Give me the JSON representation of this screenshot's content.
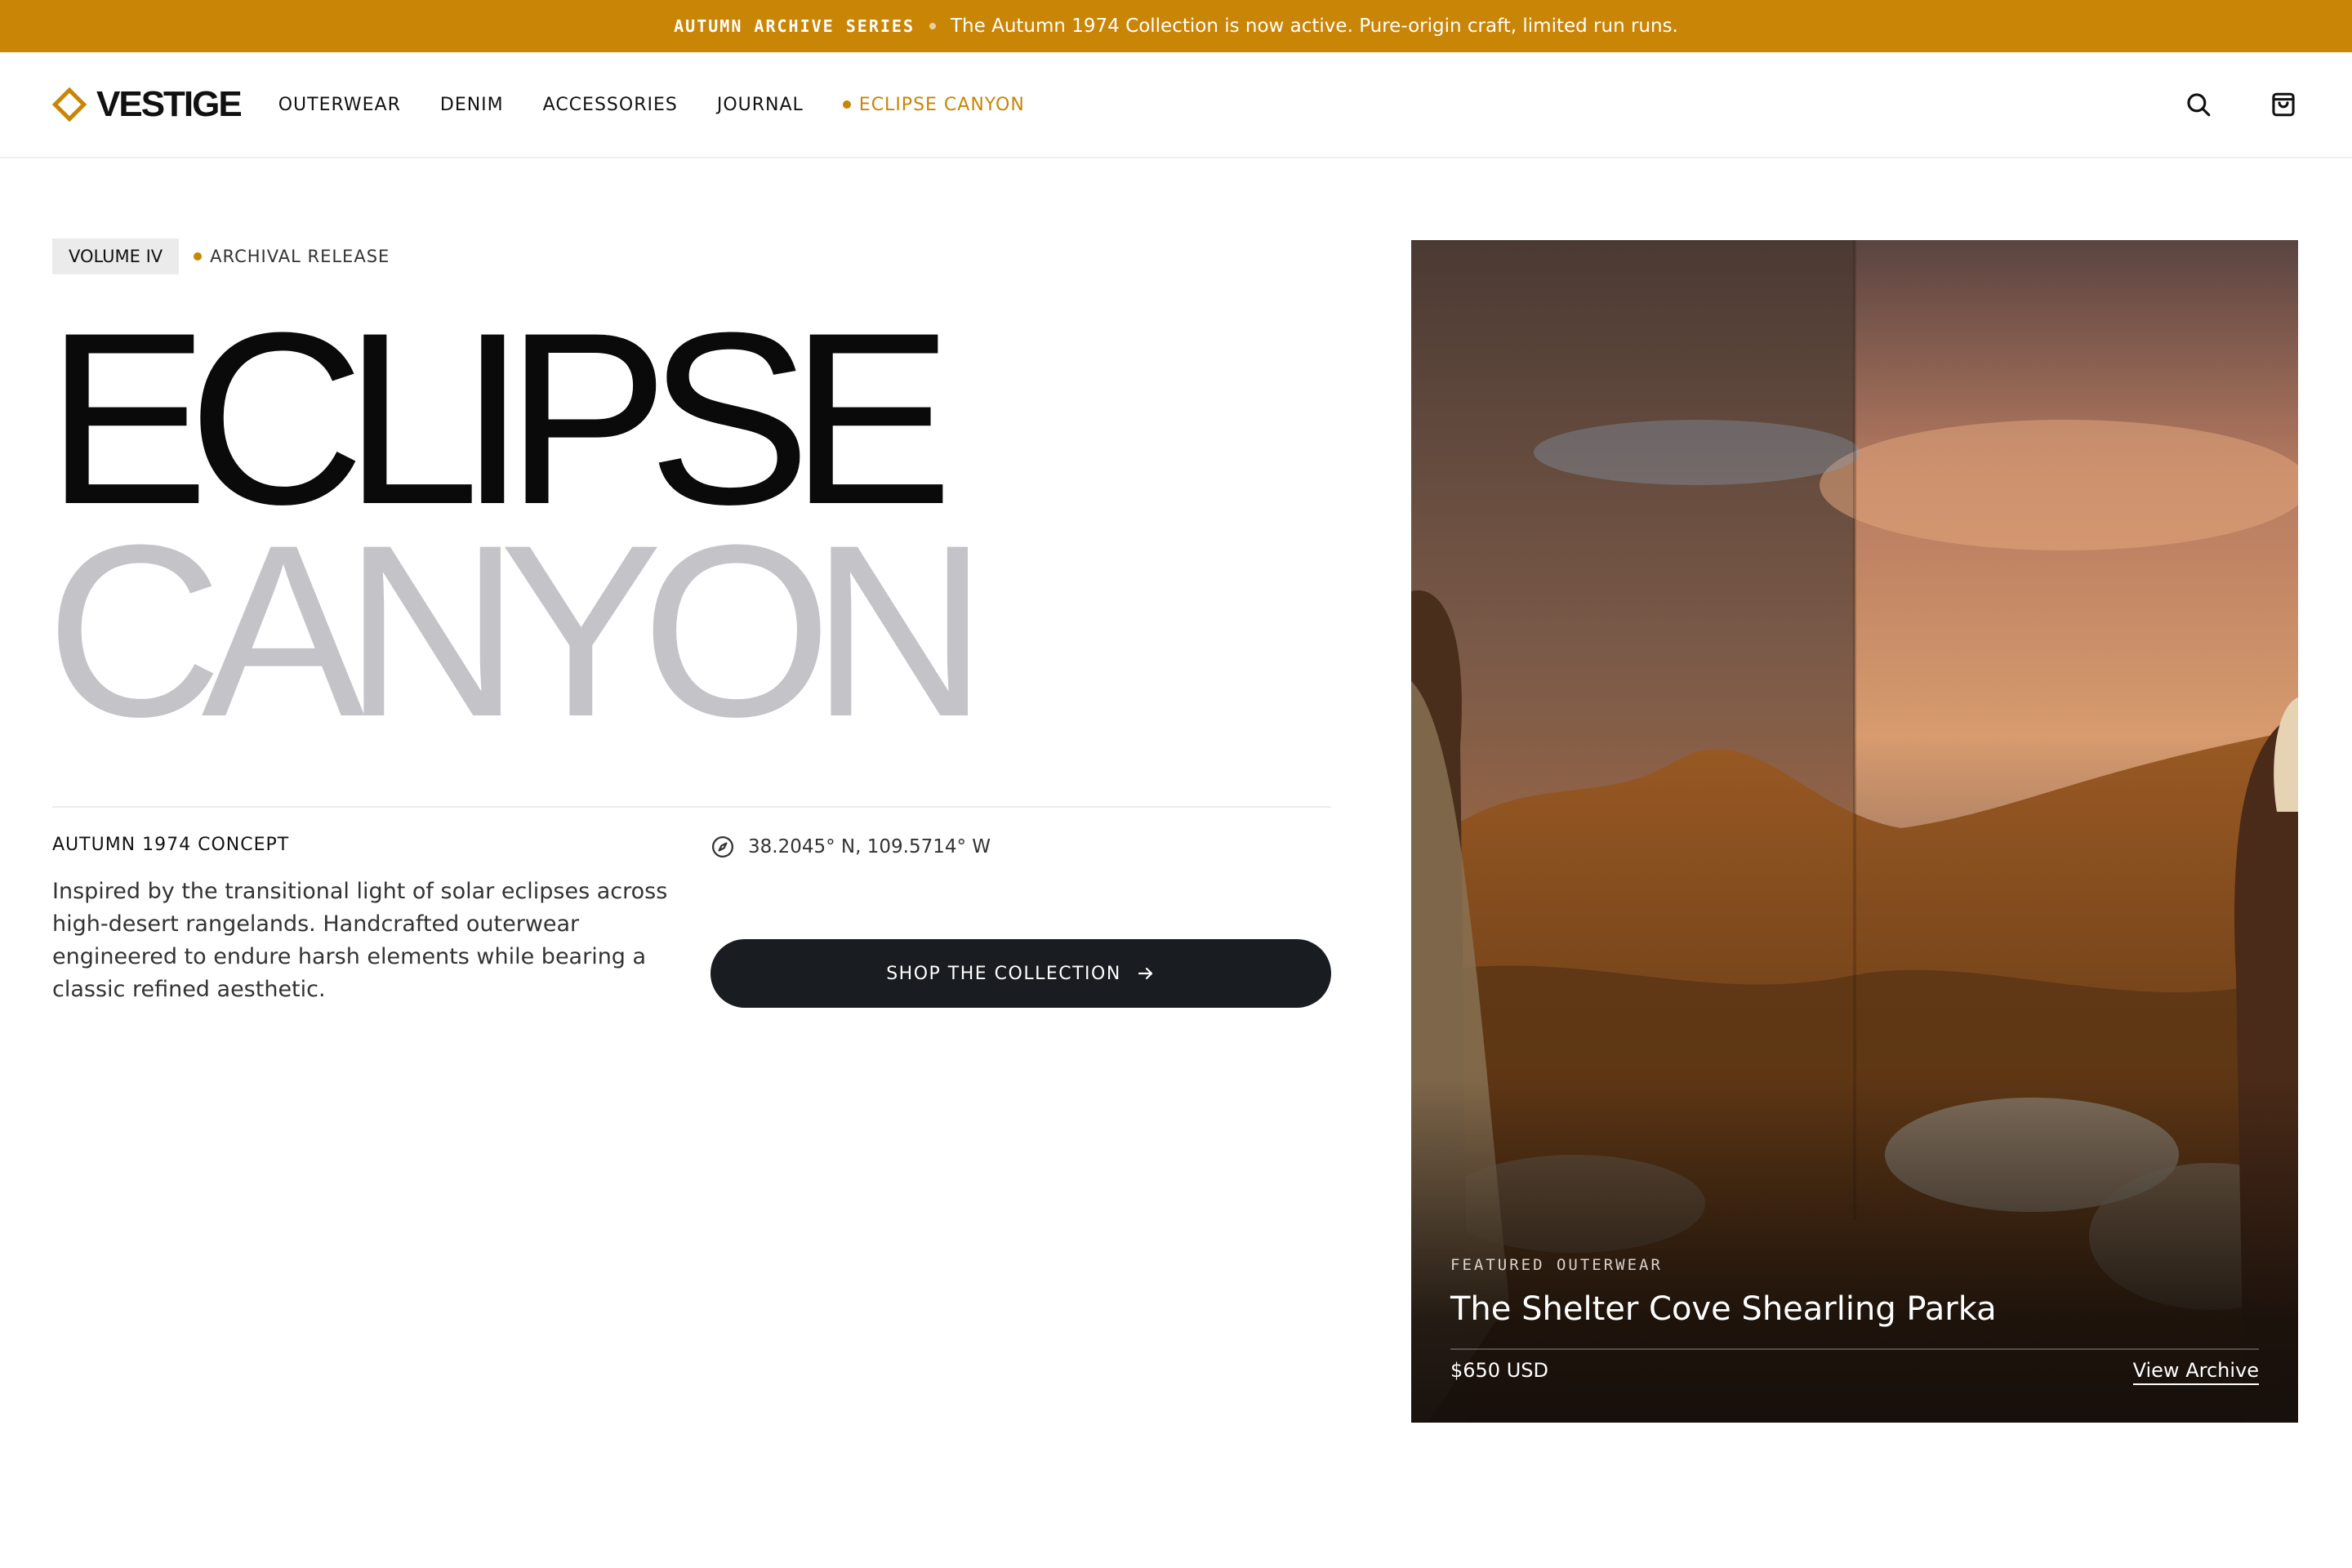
{
  "announcement": {
    "series": "AUTUMN ARCHIVE SERIES",
    "message": "The Autumn 1974 Collection is now active. Pure-origin craft, limited run runs."
  },
  "header": {
    "logo": "VESTIGE",
    "nav": [
      {
        "label": "OUTERWEAR"
      },
      {
        "label": "DENIM"
      },
      {
        "label": "ACCESSORIES"
      },
      {
        "label": "JOURNAL"
      },
      {
        "label": "ECLIPSE CANYON"
      }
    ],
    "icons": [
      "search-icon",
      "shopping-bag-icon"
    ]
  },
  "hero": {
    "tag": "VOLUME IV",
    "tag_sub": "ARCHIVAL RELEASE",
    "title_line1": "ECLIPSE",
    "title_line2": "CANYON",
    "concept": "AUTUMN 1974 CONCEPT",
    "description": "Inspired by the transitional light of solar eclipses across high-desert rangelands. Handcrafted outerwear engineered to endure harsh elements while bearing a classic refined aesthetic.",
    "coordinates": "38.2045° N, 109.5714° W",
    "cta": "SHOP THE COLLECTION"
  },
  "feature": {
    "label": "FEATURED OUTERWEAR",
    "title": "The Shelter Cove Shearling Parka",
    "price": "$650 USD",
    "link": "View Archive"
  },
  "colors": {
    "accent": "#c98505",
    "button": "#191c20",
    "title_muted": "#c4c4c8"
  }
}
